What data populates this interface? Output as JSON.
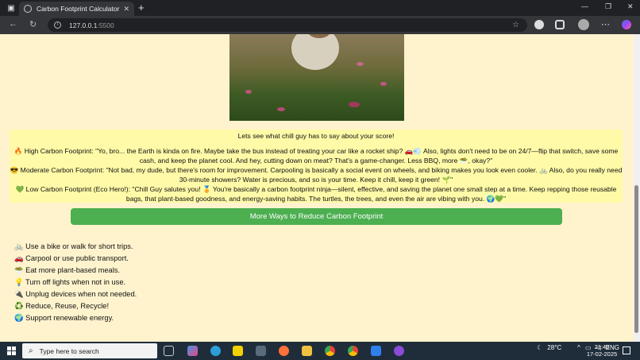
{
  "browser": {
    "tab_title": "Carbon Footprint Calculator",
    "url_host": "127.0.0.1",
    "url_port": ":5500"
  },
  "page": {
    "intro": "Lets see what chill guy has to say about your score!",
    "high": {
      "line1": "🔥 High Carbon Footprint: \"Yo, bro... the Earth is kinda on fire. Maybe take the bus instead of treating your car like a rocket ship? 🚗💨 Also, lights don't need to be on 24/7—flip that switch, save some",
      "line2": "cash, and keep the planet cool. And hey, cutting down on meat? That's a game-changer. Less BBQ, more 🥗, okay?\""
    },
    "moderate": {
      "line1": "😎 Moderate Carbon Footprint: \"Not bad, my dude, but there's room for improvement. Carpooling is basically a social event on wheels, and biking makes you look even cooler. 🚲 Also, do you really need",
      "line2": "30-minute showers? Water is precious, and so is your time. Keep it chill, keep it green! 🌱\""
    },
    "low": {
      "line1": "💚 Low Carbon Footprint (Eco Hero!): \"Chill Guy salutes you! 🏅 You're basically a carbon footprint ninja—silent, effective, and saving the planet one small step at a time. Keep repping those reusable",
      "line2": "bags, that plant-based goodness, and energy-saving habits. The turtles, the trees, and even the air are vibing with you. 🌍💚\""
    },
    "more_button": "More Ways to Reduce Carbon Footprint",
    "tips": [
      "🚲 Use a bike or walk for short trips.",
      "🚗 Carpool or use public transport.",
      "🥗 Eat more plant-based meals.",
      "💡 Turn off lights when not in use.",
      "🔌 Unplug devices when not needed.",
      "♻️ Reduce, Reuse, Recycle!",
      "🌍 Support renewable energy."
    ]
  },
  "taskbar": {
    "search_placeholder": "Type here to search",
    "temperature": "28°C",
    "language": "ENG",
    "time": "21:49",
    "date": "17-02-2025"
  }
}
